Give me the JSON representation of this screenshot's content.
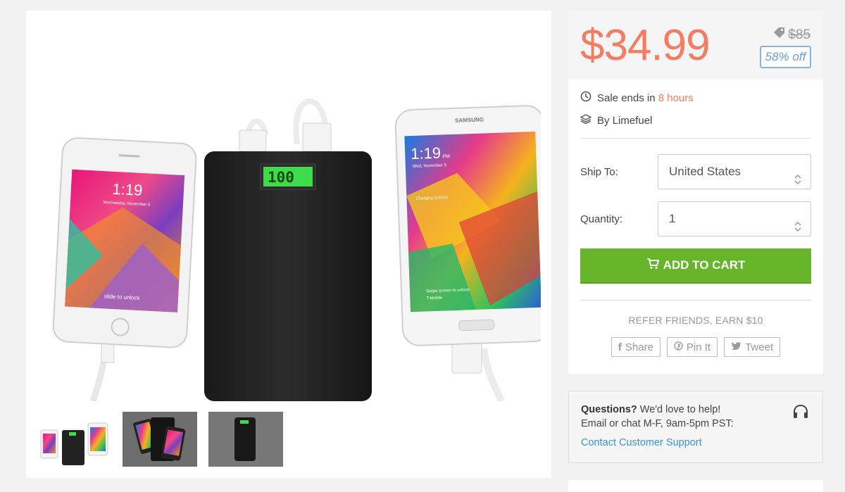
{
  "product": {
    "price": "$34.99",
    "original_price": "$85",
    "discount_badge": "58% off",
    "sale_prefix": "Sale ends in ",
    "sale_time": "8 hours",
    "brand": "By Limefuel"
  },
  "form": {
    "ship_label": "Ship To:",
    "ship_value": "United States",
    "quantity_label": "Quantity:",
    "quantity_value": "1",
    "add_to_cart": "ADD TO CART"
  },
  "refer": {
    "text": "REFER FRIENDS, EARN $10",
    "share": "Share",
    "pin": "Pin It",
    "tweet": "Tweet"
  },
  "help": {
    "title": "Questions?",
    "line1_rest": " We'd love to help!",
    "line2": "Email or chat M-F, 9am-5pm PST:",
    "link": "Contact Customer Support"
  },
  "image": {
    "iphone_time": "1:19",
    "iphone_date": "Wednesday, November 5",
    "iphone_slide": "slide to unlock",
    "battery_display": "100",
    "samsung_brand": "SAMSUNG",
    "samsung_time": "1:19",
    "samsung_pm": "PM",
    "samsung_date": "Wed, November 5",
    "samsung_charging": "Charging (100%)",
    "samsung_swipe": "Swipe screen to unlock",
    "samsung_carrier": "T-Mobile"
  },
  "colors": {
    "price": "#f47c63",
    "badge": "#6b9fd1",
    "cart": "#67b52a",
    "link": "#3a93d4"
  },
  "icons": [
    "tag-icon",
    "clock-icon",
    "layers-icon",
    "cart-icon",
    "facebook-icon",
    "pinterest-icon",
    "twitter-icon",
    "headset-icon"
  ]
}
